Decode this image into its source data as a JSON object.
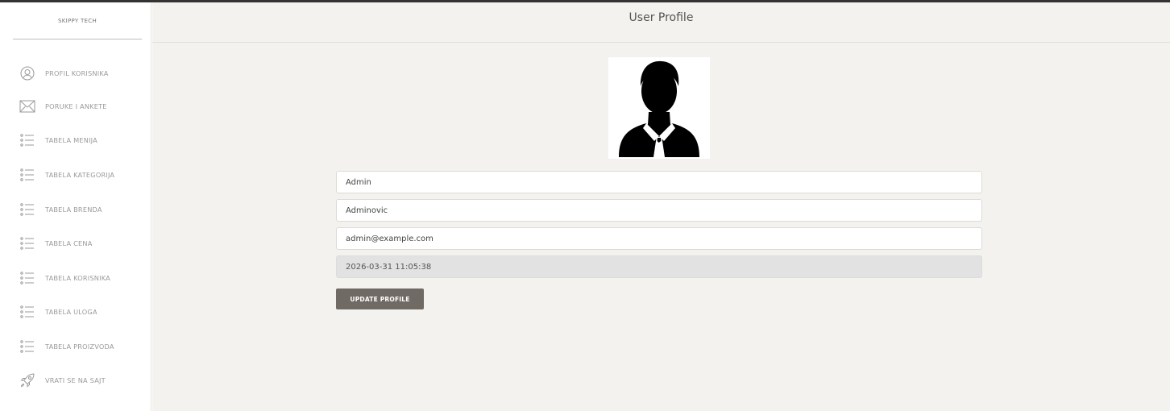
{
  "brand": "SKIPPY TECH",
  "sidebar": {
    "items": [
      {
        "label": "PROFIL KORISNIKA",
        "icon": "user-circle-icon"
      },
      {
        "label": "PORUKE I ANKETE",
        "icon": "envelope-icon"
      },
      {
        "label": "TABELA MENIJA",
        "icon": "list-icon"
      },
      {
        "label": "TABELA KATEGORIJA",
        "icon": "list-icon"
      },
      {
        "label": "TABELA BRENDA",
        "icon": "list-icon"
      },
      {
        "label": "TABELA CENA",
        "icon": "list-icon"
      },
      {
        "label": "TABELA KORISNIKA",
        "icon": "list-icon"
      },
      {
        "label": "TABELA ULOGA",
        "icon": "list-icon"
      },
      {
        "label": "TABELA PROIZVODA",
        "icon": "list-icon"
      },
      {
        "label": "VRATI SE NA SAJT",
        "icon": "rocket-icon"
      }
    ]
  },
  "header": {
    "title": "User Profile"
  },
  "profile": {
    "first_name": "Admin",
    "last_name": "Adminovic",
    "email": "admin@example.com",
    "created_at": "2026-03-31 11:05:38"
  },
  "actions": {
    "update_label": "UPDATE PROFILE"
  },
  "colors": {
    "sidebar_bg": "#ffffff",
    "main_bg": "#f3f2ef",
    "button_bg": "#6f6a63",
    "readonly_bg": "#e2e2e2"
  }
}
